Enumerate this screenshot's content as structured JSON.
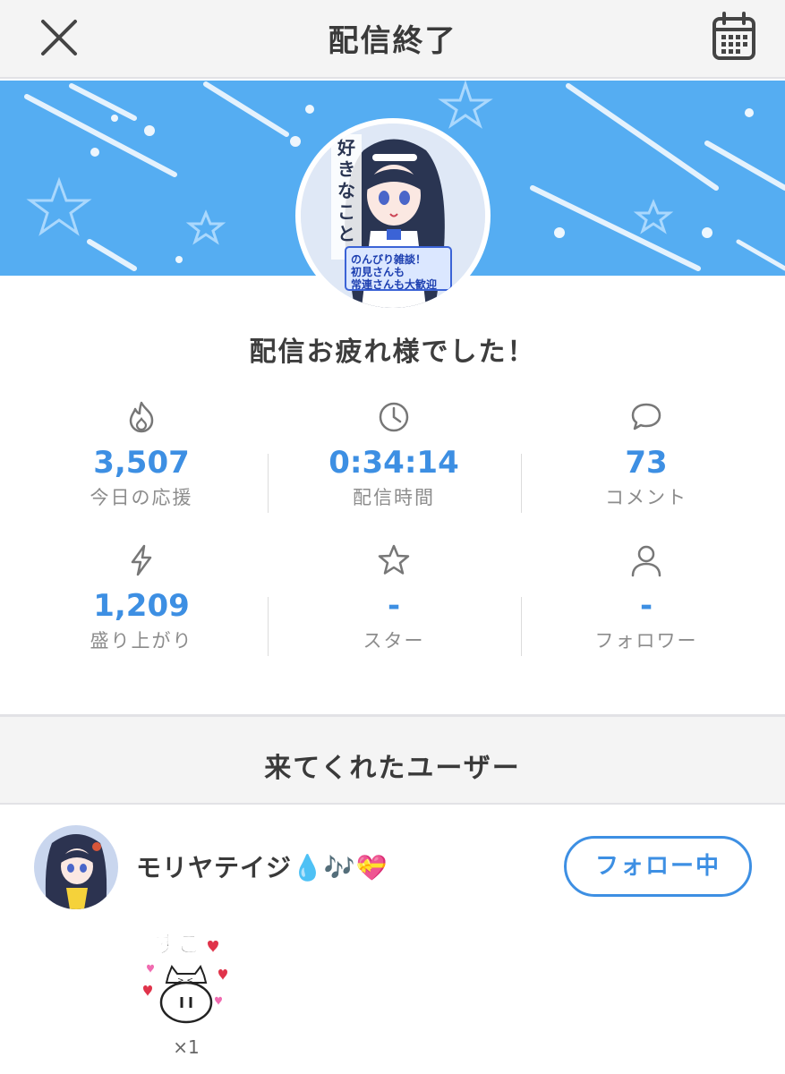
{
  "header": {
    "title": "配信終了",
    "close_icon": "close-icon",
    "calendar_icon": "calendar-icon"
  },
  "banner": {
    "avatar_text_vertical": "好きなことつめあわせ",
    "avatar_caption": "のんびり雑談！初見さんも常連さんも大歓迎"
  },
  "thanks": "配信お疲れ様でした！",
  "stats": [
    {
      "icon": "flame-icon",
      "value": "3,507",
      "label": "今日の応援"
    },
    {
      "icon": "clock-icon",
      "value": "0:34:14",
      "label": "配信時間"
    },
    {
      "icon": "comment-icon",
      "value": "73",
      "label": "コメント"
    },
    {
      "icon": "lightning-icon",
      "value": "1,209",
      "label": "盛り上がり"
    },
    {
      "icon": "star-icon",
      "value": "-",
      "label": "スター"
    },
    {
      "icon": "person-icon",
      "value": "-",
      "label": "フォロワー"
    }
  ],
  "section": {
    "title": "来てくれたユーザー"
  },
  "visitor": {
    "name": "モリヤテイジ💧🎶💝",
    "follow_label": "フォロー中",
    "sticker_text": "すこ",
    "sticker_count": "×1"
  },
  "colors": {
    "accent": "#3d8fe3",
    "banner": "#55adf2"
  }
}
